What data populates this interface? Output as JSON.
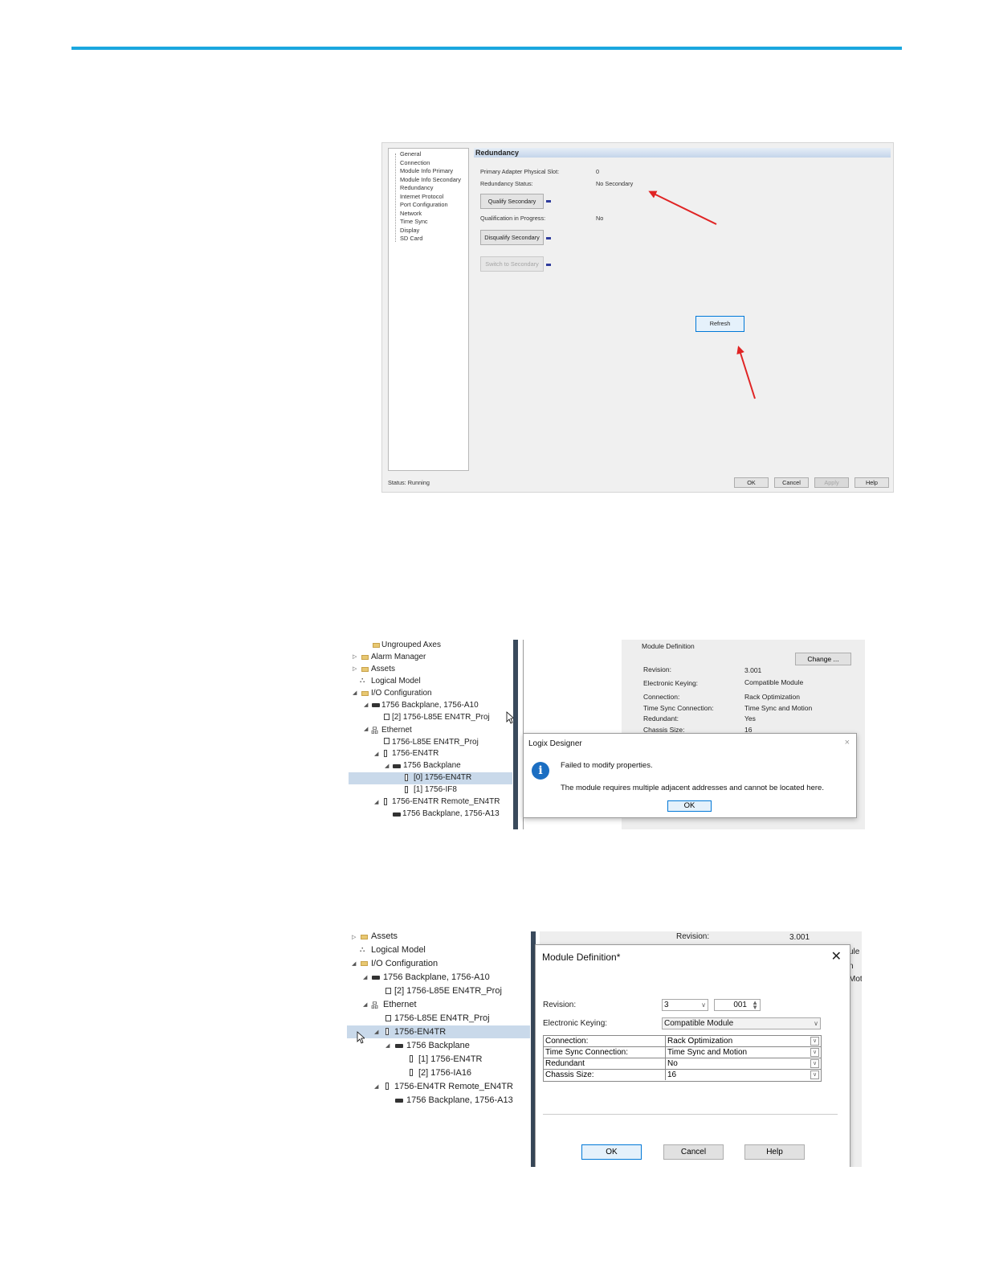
{
  "colors": {
    "accent_bar": "#1aa7df",
    "arrow": "#e02424",
    "selection": "#c9d9ea",
    "focus_border": "#0078d7"
  },
  "shot1": {
    "tree_items": [
      "General",
      "Connection",
      "Module Info Primary",
      "Module Info Secondary",
      "Redundancy",
      "Internet Protocol",
      "Port Configuration",
      "Network",
      "Time Sync",
      "Display",
      "SD Card"
    ],
    "header": "Redundancy",
    "primary_slot_label": "Primary Adapter Physical Slot:",
    "primary_slot_value": "0",
    "redundancy_status_label": "Redundancy Status:",
    "redundancy_status_value": "No Secondary",
    "qualify_button": "Qualify Secondary",
    "qualification_label": "Qualification in Progress:",
    "qualification_value": "No",
    "disqualify_button": "Disqualify Secondary",
    "switch_button": "Switch to Secondary",
    "refresh_button": "Refresh",
    "status_text": "Status:  Running",
    "ok_button": "OK",
    "cancel_button": "Cancel",
    "apply_button": "Apply",
    "help_button": "Help"
  },
  "shot2": {
    "tree": {
      "ungrouped_axes": "Ungrouped Axes",
      "alarm_manager": "Alarm Manager",
      "assets": "Assets",
      "logical_model": "Logical Model",
      "io_configuration": "I/O Configuration",
      "backplane": "1756 Backplane, 1756-A10",
      "controller_slot": "[2] 1756-L85E EN4TR_Proj",
      "ethernet": "Ethernet",
      "controller_eth": "1756-L85E EN4TR_Proj",
      "en4tr": "1756-EN4TR",
      "backplane2": "1756 Backplane",
      "slot0": "[0] 1756-EN4TR",
      "slot1": "[1] 1756-IF8",
      "remote": "1756-EN4TR Remote_EN4TR",
      "remote_backplane": "1756 Backplane, 1756-A13"
    },
    "module_definition": {
      "title": "Module Definition",
      "change_button": "Change ...",
      "revision_label": "Revision:",
      "revision_value": "3.001",
      "keying_label": "Electronic Keying:",
      "keying_value": "Compatible Module",
      "connection_label": "Connection:",
      "connection_value": "Rack Optimization",
      "timesync_label": "Time Sync Connection:",
      "timesync_value": "Time Sync and Motion",
      "redundant_label": "Redundant:",
      "redundant_value": "Yes",
      "chassis_label": "Chassis Size:",
      "chassis_value": "16"
    },
    "dialog": {
      "title": "Logix Designer",
      "close": "×",
      "info_icon": "i",
      "message1": "Failed to modify properties.",
      "message2": "The module requires multiple adjacent addresses and cannot be located here.",
      "ok_button": "OK"
    }
  },
  "shot3": {
    "tree": {
      "assets": "Assets",
      "logical_model": "Logical Model",
      "io_configuration": "I/O Configuration",
      "backplane": "1756 Backplane, 1756-A10",
      "controller_slot": "[2] 1756-L85E EN4TR_Proj",
      "ethernet": "Ethernet",
      "controller_eth": "1756-L85E EN4TR_Proj",
      "en4tr": "1756-EN4TR",
      "backplane2": "1756 Backplane",
      "slot1": "[1] 1756-EN4TR",
      "slot2": "[2] 1756-IA16",
      "remote": "1756-EN4TR Remote_EN4TR",
      "remote_backplane": "1756 Backplane, 1756-A13"
    },
    "bg_revision_label": "Revision:",
    "bg_revision_value": "3.001",
    "bg_fragment1": "ule",
    "bg_fragment2": "n",
    "bg_fragment3": "Moti",
    "dialog": {
      "title": "Module Definition*",
      "close": "✕",
      "revision_label": "Revision:",
      "revision_major": "3",
      "revision_minor": "001",
      "keying_label": "Electronic Keying:",
      "keying_value": "Compatible Module",
      "rows": [
        {
          "key": "Connection:",
          "value": "Rack Optimization"
        },
        {
          "key": "Time Sync Connection:",
          "value": "Time Sync and Motion"
        },
        {
          "key": "Redundant",
          "value": "No"
        },
        {
          "key": "Chassis Size:",
          "value": "16"
        }
      ],
      "ok_button": "OK",
      "cancel_button": "Cancel",
      "help_button": "Help"
    }
  }
}
